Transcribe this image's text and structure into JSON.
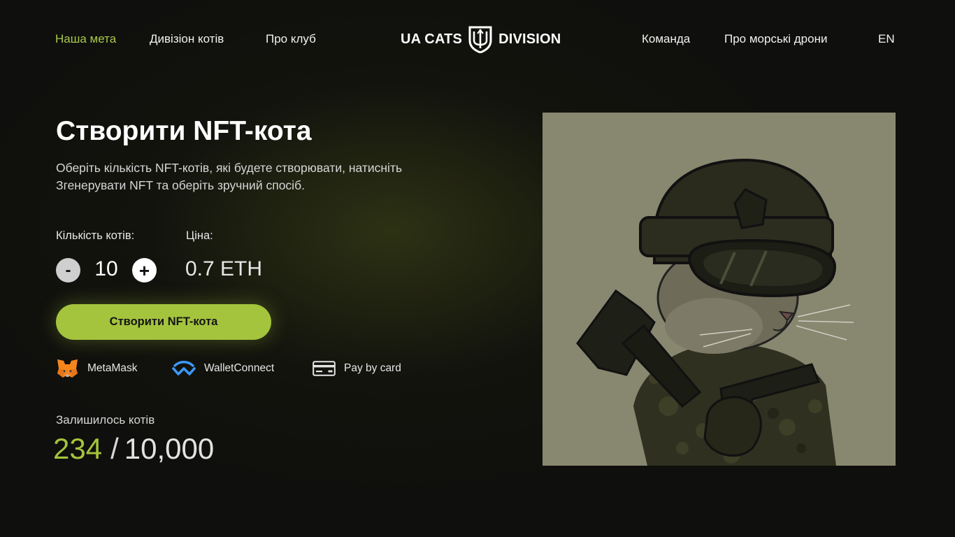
{
  "nav": {
    "left": [
      "Наша мета",
      "Дивізіон котів",
      "Про клуб"
    ],
    "right": [
      "Команда",
      "Про морські дрони",
      "EN"
    ],
    "active_index": 0,
    "logo_left": "UA CATS",
    "logo_right": "DIVISION",
    "logo_icon": "trident-shield-icon"
  },
  "hero": {
    "title": "Створити NFT-кота",
    "subtitle": "Оберіть кількість NFT-котів, які будете створювати, натисніть Згенерувати NFT та оберіть зручний спосіб.",
    "quantity_label": "Кількість котів:",
    "price_label": "Ціна:",
    "quantity": "10",
    "minus": "-",
    "plus": "+",
    "price": "0.7 ETH",
    "cta": "Створити NFT-кота",
    "payments": [
      {
        "label": "MetaMask",
        "icon": "metamask-fox-icon"
      },
      {
        "label": "WalletConnect",
        "icon": "walletconnect-icon"
      },
      {
        "label": "Pay by card",
        "icon": "credit-card-icon"
      }
    ],
    "remaining_label": "Залишилось котів",
    "remaining": "234",
    "separator": "/",
    "total": "10,000"
  },
  "colors": {
    "accent": "#a4c43d",
    "background": "#0f0f0d",
    "art_background": "#888770"
  }
}
